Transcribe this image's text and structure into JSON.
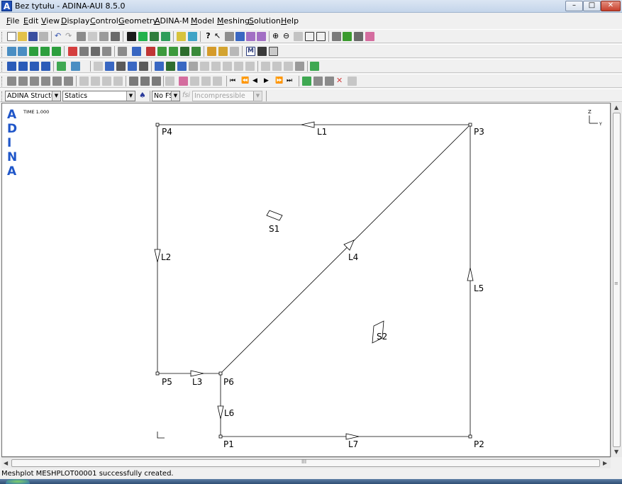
{
  "window": {
    "title": "Bez tytułu - ADINA-AUI  8.5.0",
    "icon_letter": "A"
  },
  "menu": [
    "File",
    "Edit",
    "View",
    "Display",
    "Control",
    "Geometry",
    "ADINA-M",
    "Model",
    "Meshing",
    "Solution",
    "Help"
  ],
  "controls": {
    "program": "ADINA Structur",
    "analysis": "Statics",
    "fsi": "No FS",
    "fsi_label": "fsi",
    "fluid_type": "Incompressible"
  },
  "canvas": {
    "logo": [
      "A",
      "D",
      "I",
      "N",
      "A"
    ],
    "time_label": "TIME 1.000",
    "triad": {
      "z": "Z",
      "y": "Y"
    },
    "points": [
      "P1",
      "P2",
      "P3",
      "P4",
      "P5",
      "P6"
    ],
    "lines": [
      "L1",
      "L2",
      "L3",
      "L4",
      "L5",
      "L6",
      "L7"
    ],
    "surfaces": [
      "S1",
      "S2"
    ]
  },
  "scroll": {
    "h_thumb_label": "III"
  },
  "status": {
    "message": "Meshplot MESHPLOT00001 successfully created."
  }
}
